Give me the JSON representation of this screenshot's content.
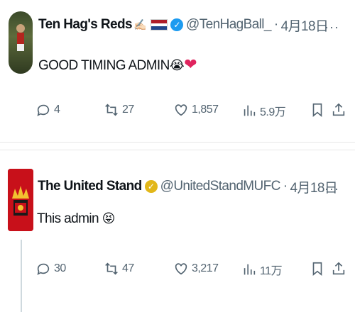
{
  "tweets": [
    {
      "name": "Ten Hag's Reds",
      "handle": "@TenHagBall_",
      "dot": "·",
      "date": "4月18日",
      "text": "GOOD TIMING ADMIN",
      "replies": "4",
      "reposts": "27",
      "likes": "1,857",
      "views": "5.9万",
      "verified_color": "#1d9bf0",
      "icons": [
        "hand-icon",
        "netherlands-flag-icon",
        "verified-badge-icon",
        "crying-face-icon",
        "heart-icon"
      ]
    },
    {
      "name": "The United Stand",
      "handle": "@UnitedStandMUFC",
      "dot": "·",
      "date": "4月18日",
      "text": "This admin",
      "replies": "30",
      "reposts": "47",
      "likes": "3,217",
      "views": "11万",
      "verified_color": "#e2b719",
      "icons": [
        "gold-verified-badge-icon",
        "tongue-face-icon"
      ]
    }
  ],
  "more_label": "···"
}
